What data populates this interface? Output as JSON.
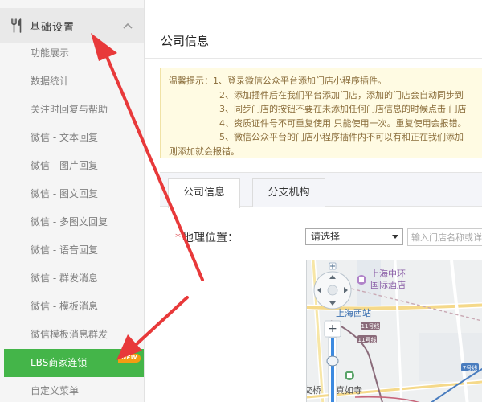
{
  "sidebar": {
    "header": {
      "title": "基础设置",
      "icon": "tools-icon",
      "expand_icon": "chevron-up-icon"
    },
    "items": [
      {
        "label": "功能展示"
      },
      {
        "label": "数据统计"
      },
      {
        "label": "关注时回复与帮助"
      },
      {
        "label": "微信 - 文本回复"
      },
      {
        "label": "微信 - 图片回复"
      },
      {
        "label": "微信 - 图文回复"
      },
      {
        "label": "微信 - 多图文回复"
      },
      {
        "label": "微信 - 语音回复"
      },
      {
        "label": "微信 - 群发消息"
      },
      {
        "label": "微信 - 模板消息"
      },
      {
        "label": "微信模板消息群发"
      },
      {
        "label": "LBS商家连锁",
        "active": true,
        "badge": "NEW"
      },
      {
        "label": "自定义菜单"
      }
    ],
    "active_color": "#44b549",
    "badge_color": "#f39c12"
  },
  "main": {
    "title": "公司信息",
    "notice": {
      "lines": [
        "温馨提示：1、登录微信公众平台添加门店小程序插件。",
        "2、添加插件后在我们平台添加门店，添加的门店会自动同步到",
        "3、同步门店的按钮不要在未添加任何门店信息的时候点击 门店",
        "4、资质证件号不可重复使用 只能使用一次。重复使用会报错。",
        "5、微信公众平台的门店小程序插件内不可以有和正在我们添加",
        "则添加就会报错。"
      ]
    },
    "tabs": [
      {
        "label": "公司信息",
        "active": true
      },
      {
        "label": "分支机构",
        "active": false
      }
    ],
    "form": {
      "geo_label": "地理位置：",
      "required_mark": "*",
      "province_select": {
        "value": "请选择"
      },
      "search": {
        "placeholder": "输入门店名称或详细地址"
      }
    },
    "map": {
      "labels": {
        "hotel": "上海中环",
        "hotel2": "国际酒店",
        "station": "上海西站",
        "metro1": "11号线",
        "metro2": "11号线",
        "metro3": "7号线",
        "temple": "真如寺",
        "bridge": "交桥"
      },
      "zoom_plus": "+",
      "zoom_level": 0.5,
      "icons": [
        "pan-control-icon",
        "zoom-in-icon",
        "zoom-slider-icon",
        "hotel-pin-icon",
        "metro-icon",
        "temple-pin-icon"
      ]
    }
  },
  "annotations": {
    "arrow_color": "#e8393a"
  }
}
